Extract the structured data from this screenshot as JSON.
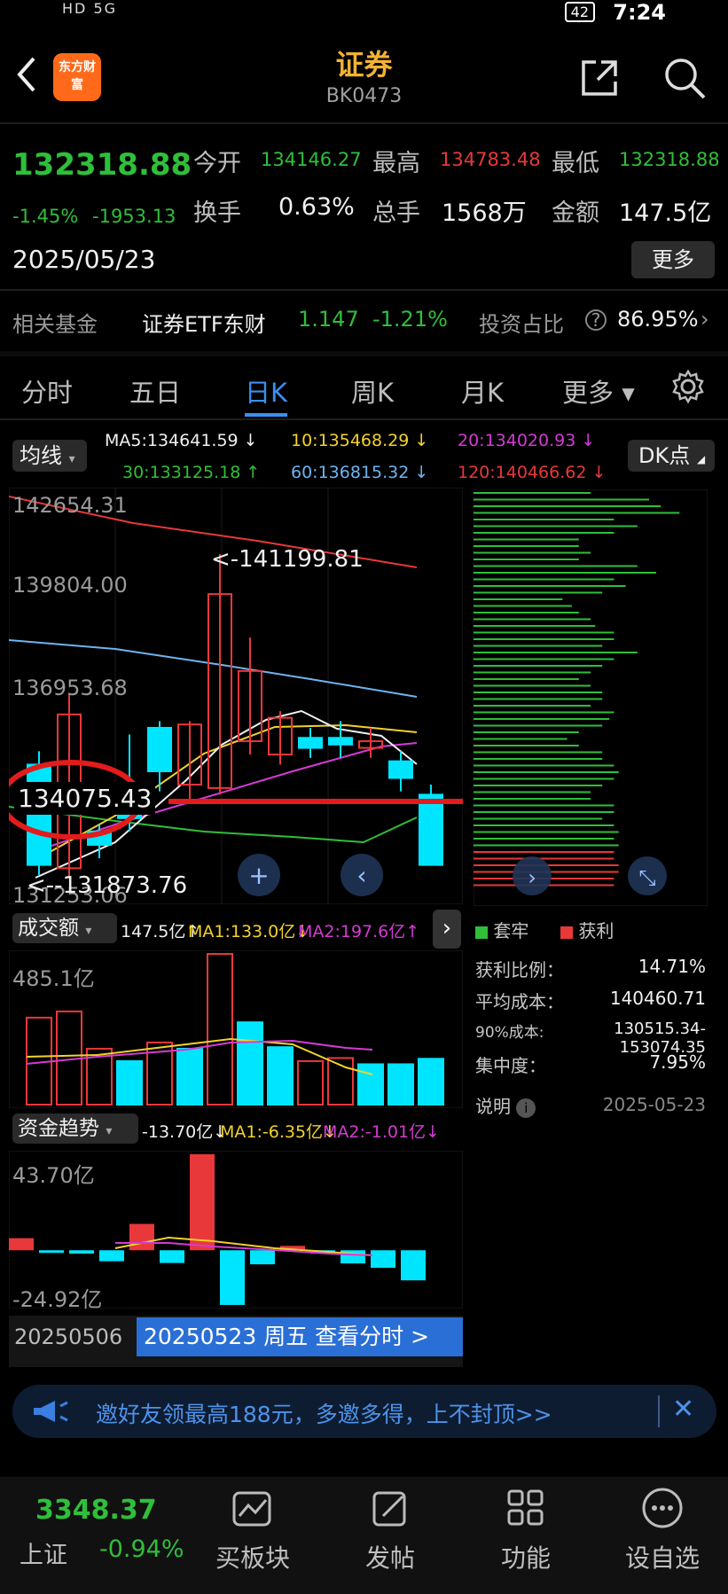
{
  "status": {
    "time": "7:24",
    "battery": "42",
    "left_icons": "HD 5G"
  },
  "header": {
    "title": "证券",
    "code": "BK0473",
    "logo_text": "东方财富"
  },
  "quote": {
    "price": "132318.88",
    "pct": "-1.45%",
    "change": "-1953.13",
    "date": "2025/05/23",
    "open_label": "今开",
    "open": "134146.27",
    "high_label": "最高",
    "high": "134783.48",
    "low_label": "最低",
    "low": "132318.88",
    "turnover_label": "换手",
    "turnover": "0.63%",
    "volume_label": "总手",
    "volume": "1568万",
    "amount_label": "金额",
    "amount": "147.5亿",
    "more": "更多"
  },
  "fund": {
    "label": "相关基金",
    "name": "证券ETF东财",
    "price": "1.147",
    "pct": "-1.21%",
    "ratio_label": "投资占比",
    "ratio": "86.95%"
  },
  "tabs": [
    "分时",
    "五日",
    "日K",
    "周K",
    "月K",
    "更多"
  ],
  "active_tab": 2,
  "ma": {
    "selector": "均线",
    "ma5": "MA5:134641.59",
    "ma10": "10:135468.29",
    "ma20": "20:134020.93",
    "ma30": "30:133125.18",
    "ma60": "60:136815.32",
    "ma120": "120:140466.62",
    "dk": "DK点"
  },
  "kline": {
    "y_labels": [
      "142654.31",
      "139804.00",
      "136953.68",
      "131253.06"
    ],
    "peak_annotation": "<-141199.81",
    "low_annotation": "<--131873.76",
    "circled_price": "134075.43",
    "candles": [
      {
        "o": 134900,
        "c": 131900,
        "h": 135300,
        "l": 131600
      },
      {
        "o": 131800,
        "c": 136400,
        "h": 137000,
        "l": 131500
      },
      {
        "o": 132900,
        "c": 132500,
        "h": 133100,
        "l": 132100
      },
      {
        "o": 133500,
        "c": 133300,
        "h": 135800,
        "l": 132900
      },
      {
        "o": 136000,
        "c": 134700,
        "h": 136200,
        "l": 134100
      },
      {
        "o": 134300,
        "c": 136100,
        "h": 136200,
        "l": 133800
      },
      {
        "o": 134200,
        "c": 140000,
        "h": 141199.81,
        "l": 134000
      },
      {
        "o": 135600,
        "c": 137700,
        "h": 138700,
        "l": 135200
      },
      {
        "o": 135200,
        "c": 136300,
        "h": 136500,
        "l": 134900
      },
      {
        "o": 135700,
        "c": 135400,
        "h": 136000,
        "l": 135100
      },
      {
        "o": 135700,
        "c": 135500,
        "h": 136200,
        "l": 135100
      },
      {
        "o": 135400,
        "c": 135600,
        "h": 136000,
        "l": 135100
      },
      {
        "o": 135000,
        "c": 134500,
        "h": 135300,
        "l": 134100
      },
      {
        "o": 134000,
        "c": 131900,
        "h": 134300,
        "l": 131873.76
      }
    ]
  },
  "volume": {
    "label": "成交额",
    "vol": "147.5亿↑",
    "ma1": "MA1:133.0亿↓",
    "ma2": "MA2:197.6亿↑",
    "y_label": "485.1亿",
    "bars": [
      {
        "v": 280,
        "up": false
      },
      {
        "v": 300,
        "up": false
      },
      {
        "v": 180,
        "up": false
      },
      {
        "v": 140,
        "up": true
      },
      {
        "v": 200,
        "up": false
      },
      {
        "v": 180,
        "up": true
      },
      {
        "v": 485.1,
        "up": false
      },
      {
        "v": 265,
        "up": true
      },
      {
        "v": 185,
        "up": true
      },
      {
        "v": 140,
        "up": false
      },
      {
        "v": 150,
        "up": false
      },
      {
        "v": 130,
        "up": true
      },
      {
        "v": 130,
        "up": true
      },
      {
        "v": 147.5,
        "up": true
      }
    ]
  },
  "capital": {
    "label": "资金趋势",
    "val": "-13.70亿↓",
    "ma1": "MA1:-6.35亿↓",
    "ma2": "MA2:-1.01亿↓",
    "y_top": "43.70亿",
    "y_bottom": "-24.92亿",
    "bars": [
      5.5,
      -1.2,
      -1.5,
      -5.0,
      12.0,
      -5.8,
      43.7,
      -24.9,
      -6.4,
      2.0,
      -1.5,
      -6.0,
      -8.0,
      -13.7
    ]
  },
  "date_axis": {
    "start": "20250506",
    "tooltip": "20250523 周五 查看分时 >"
  },
  "chip": {
    "legend_trap": "套牢",
    "legend_profit": "获利",
    "profit_ratio_label": "获利比例：",
    "profit_ratio": "14.71%",
    "avg_cost_label": "平均成本：",
    "avg_cost": "140460.71",
    "cost90_label": "90%成本:",
    "cost90": "130515.34-153074.35",
    "concentration_label": "集中度：",
    "concentration": "7.95%",
    "explain": "说明",
    "date": "2025-05-23",
    "bars": [
      0.5,
      0.75,
      0.8,
      0.88,
      0.6,
      0.7,
      0.6,
      0.45,
      0.45,
      0.5,
      0.45,
      0.7,
      0.78,
      0.6,
      0.65,
      0.55,
      0.38,
      0.42,
      0.45,
      0.5,
      0.52,
      0.6,
      0.6,
      0.55,
      0.7,
      0.6,
      0.55,
      0.5,
      0.45,
      0.5,
      0.55,
      0.55,
      0.5,
      0.6,
      0.58,
      0.55,
      0.45,
      0.4,
      0.45,
      0.55,
      0.55,
      0.6,
      0.62,
      0.6,
      0.55,
      0.5,
      0.5,
      0.6,
      0.6,
      0.55,
      0.6,
      0.62,
      0.6,
      0.62,
      0.6,
      0.6,
      0.62,
      0.62,
      0.6,
      0.6
    ]
  },
  "banner": {
    "text": "邀好友领最高188元，多邀多得，上不封顶>>"
  },
  "bottom_nav": {
    "index_value": "3348.37",
    "index_name": "上证",
    "index_pct": "-0.94%",
    "items": [
      "买板块",
      "发帖",
      "功能",
      "设自选"
    ]
  },
  "colors": {
    "up": "#e8383a",
    "down": "#2fbf3a",
    "accent": "#3b8ff2",
    "candle_down": "#00e5ff"
  }
}
